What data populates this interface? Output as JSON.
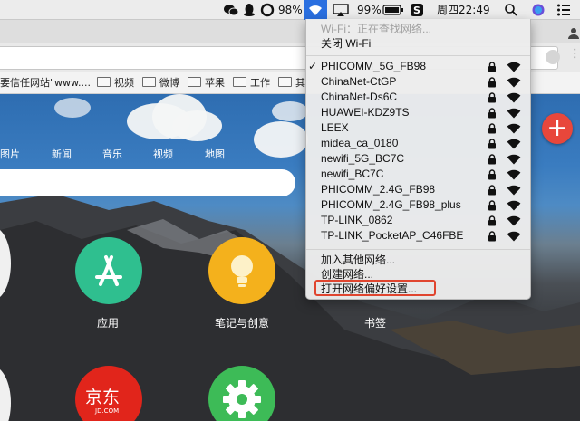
{
  "menubar": {
    "battery_percent_left": "98%",
    "battery_percent_right": "99%",
    "clock": "周四22:49",
    "icons": [
      "wechat-icon",
      "qq-icon",
      "circle-app-icon",
      "wifi-icon",
      "airplay-icon",
      "battery-icon",
      "scrivener-icon",
      "spotlight-icon",
      "siri-icon",
      "notification-center-icon"
    ]
  },
  "bookmarks": {
    "items": [
      {
        "label": "要信任网站\"www....",
        "icon": "none"
      },
      {
        "label": "视频",
        "icon": "folder-icon"
      },
      {
        "label": "微博",
        "icon": "folder-icon"
      },
      {
        "label": "苹果",
        "icon": "folder-icon"
      },
      {
        "label": "工作",
        "icon": "folder-icon"
      },
      {
        "label": "其",
        "icon": "folder-icon"
      }
    ]
  },
  "page": {
    "nav": [
      "图片",
      "新闻",
      "音乐",
      "视频",
      "地图"
    ],
    "apps": [
      {
        "label": "应用",
        "color": "#2fbf8f"
      },
      {
        "label": "笔记与创意",
        "color": "#f4b11c"
      },
      {
        "label": "书签",
        "color": ""
      },
      {
        "label": "京东",
        "sublabel": "JD.COM",
        "color": "#e1251b"
      },
      {
        "label": "",
        "color": "#3dbb57"
      }
    ],
    "plus_label": "+"
  },
  "wifi_menu": {
    "status": "Wi-Fi：正在查找网络...",
    "toggle": "关闭 Wi-Fi",
    "networks": [
      {
        "name": "PHICOMM_5G_FB98",
        "connected": true,
        "locked": true
      },
      {
        "name": "ChinaNet-CtGP",
        "connected": false,
        "locked": true
      },
      {
        "name": "ChinaNet-Ds6C",
        "connected": false,
        "locked": true
      },
      {
        "name": "HUAWEI-KDZ9TS",
        "connected": false,
        "locked": true
      },
      {
        "name": "LEEX",
        "connected": false,
        "locked": true
      },
      {
        "name": "midea_ca_0180",
        "connected": false,
        "locked": true
      },
      {
        "name": "newifi_5G_BC7C",
        "connected": false,
        "locked": true
      },
      {
        "name": "newifi_BC7C",
        "connected": false,
        "locked": true
      },
      {
        "name": "PHICOMM_2.4G_FB98",
        "connected": false,
        "locked": true
      },
      {
        "name": "PHICOMM_2.4G_FB98_plus",
        "connected": false,
        "locked": true
      },
      {
        "name": "TP-LINK_0862",
        "connected": false,
        "locked": true
      },
      {
        "name": "TP-LINK_PocketAP_C46FBE",
        "connected": false,
        "locked": true
      }
    ],
    "checkmark": "✓",
    "join_other": "加入其他网络...",
    "create_network": "创建网络...",
    "open_prefs": "打开网络偏好设置..."
  },
  "colors": {
    "menu_highlight": "#2a6fe0",
    "annotation_red": "#e0452f"
  }
}
